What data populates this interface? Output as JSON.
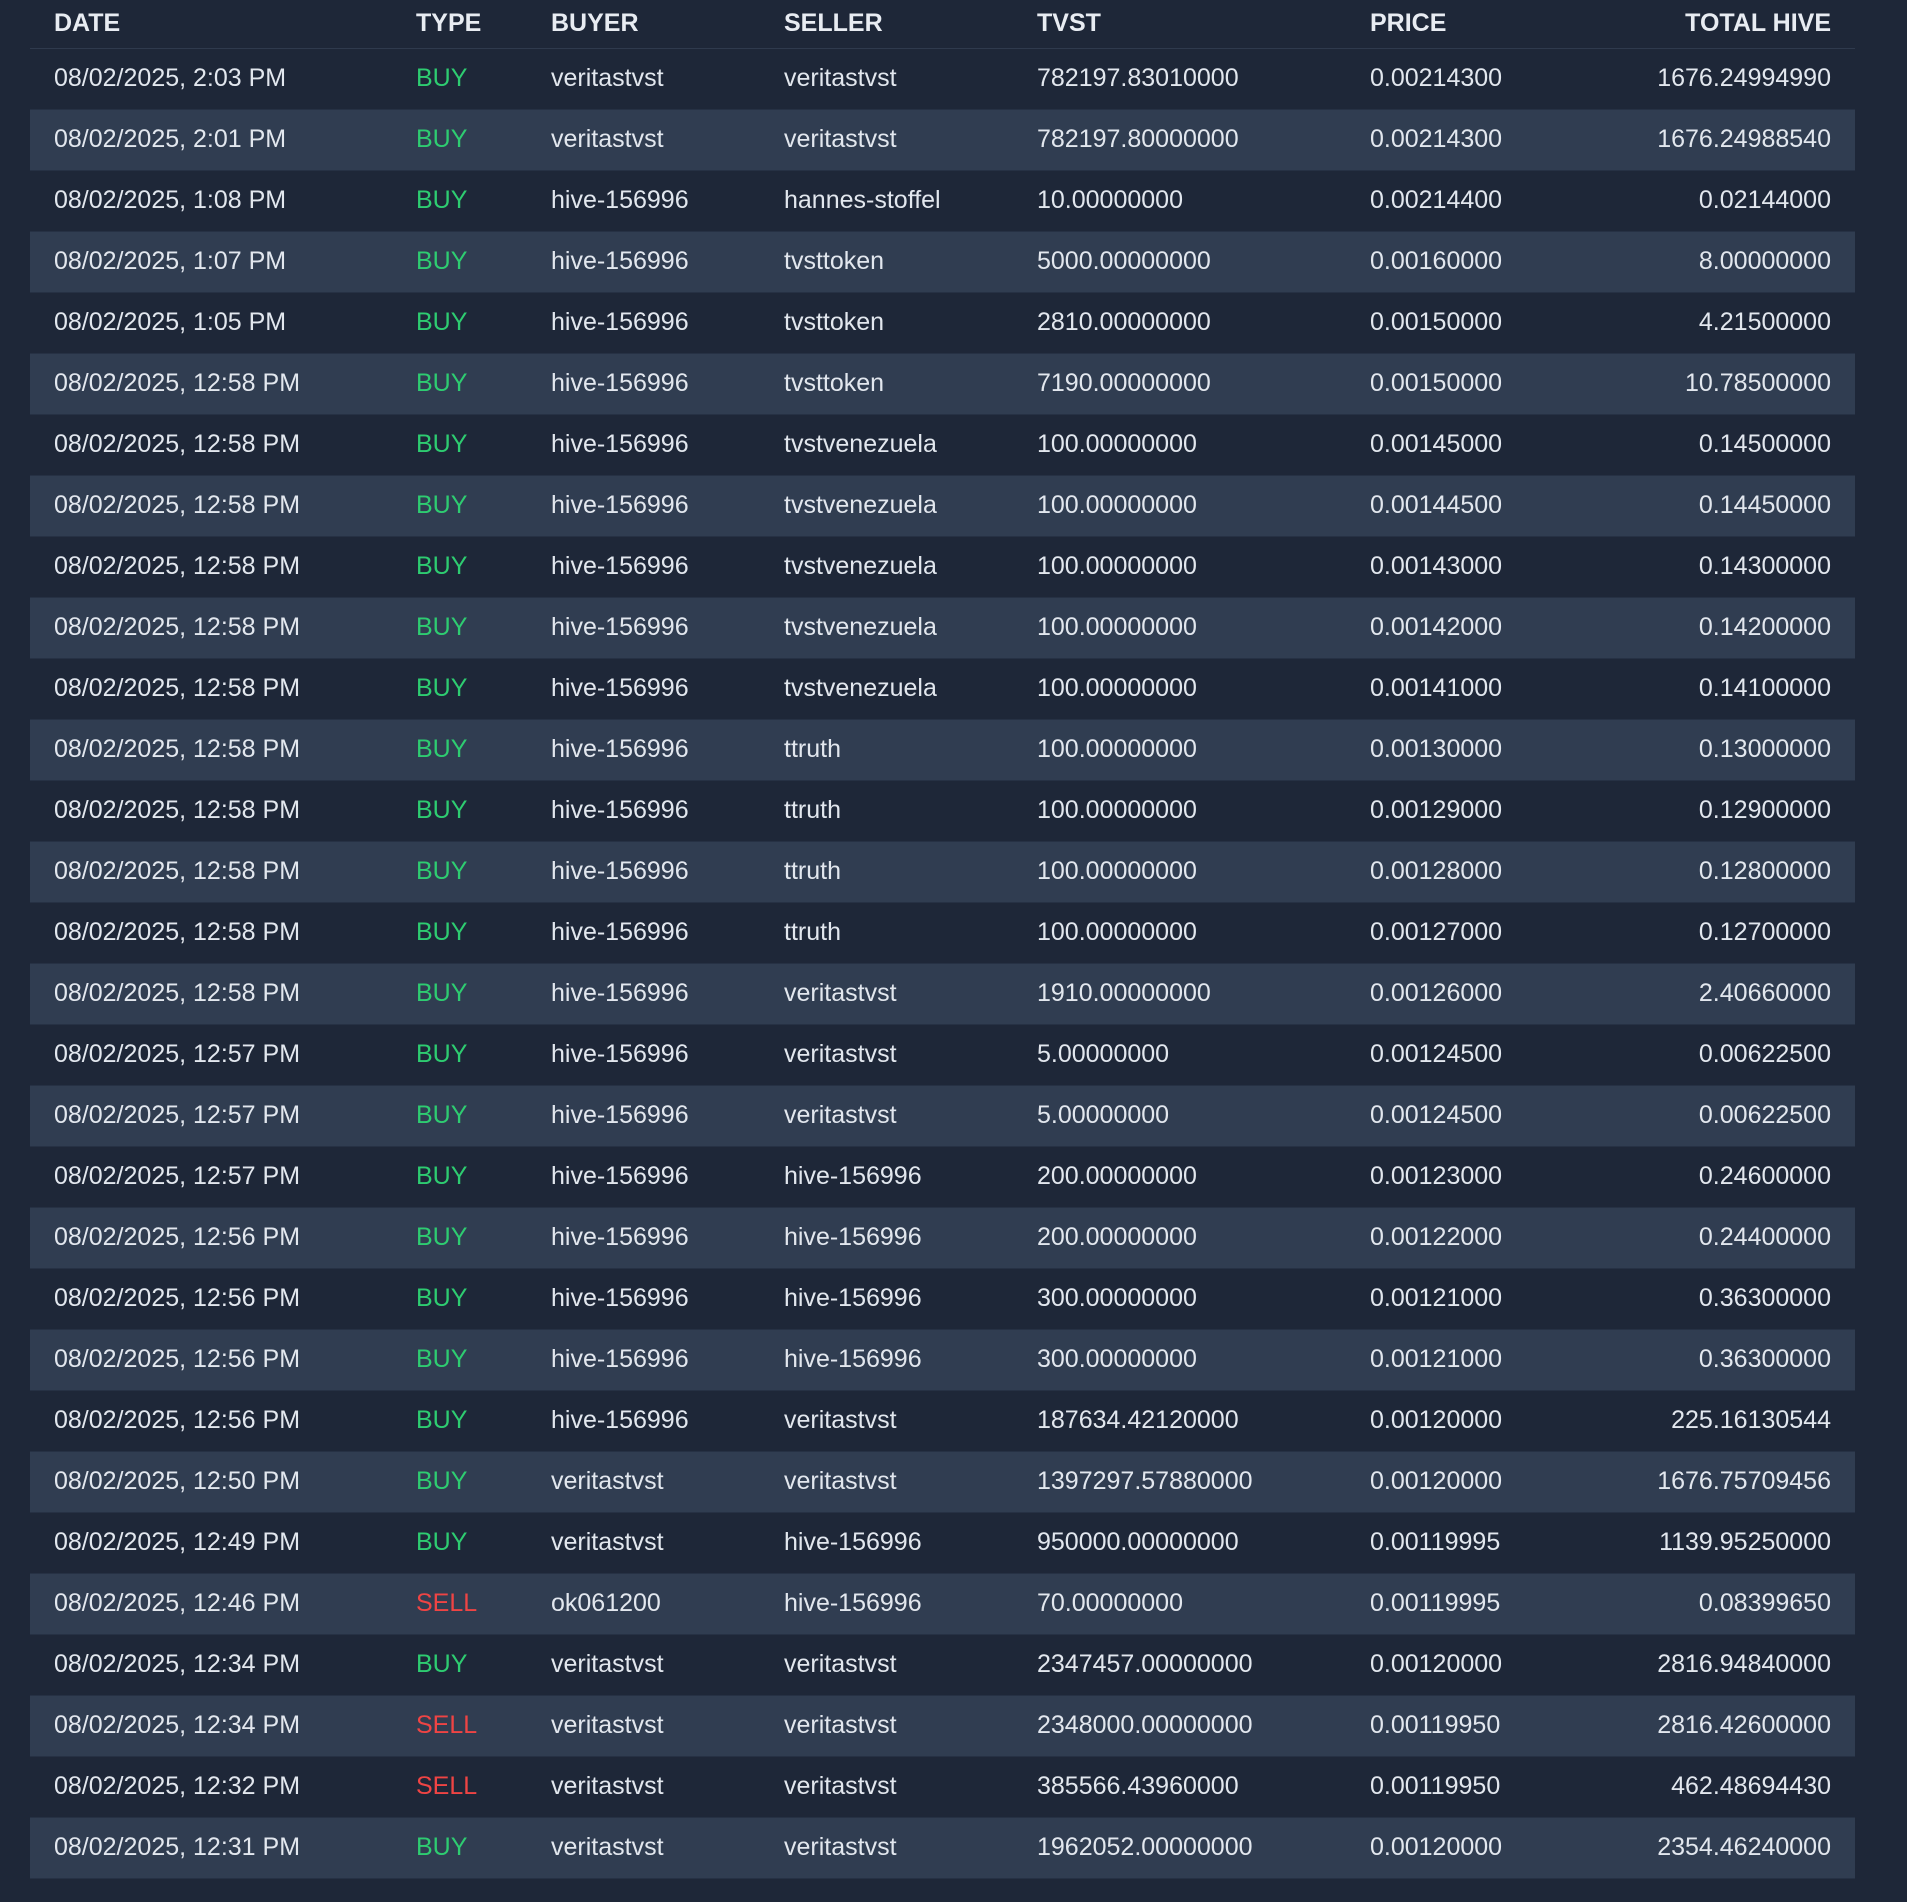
{
  "colors": {
    "background": "#1e2738",
    "row_alt": "#303d51",
    "buy": "#2ecc71",
    "sell": "#ef4444",
    "text": "#e2e7ee"
  },
  "table": {
    "headers": [
      "DATE",
      "TYPE",
      "BUYER",
      "SELLER",
      "TVST",
      "PRICE",
      "TOTAL HIVE"
    ],
    "rows": [
      [
        "08/02/2025, 2:03 PM",
        "BUY",
        "veritastvst",
        "veritastvst",
        "782197.83010000",
        "0.00214300",
        "1676.24994990"
      ],
      [
        "08/02/2025, 2:01 PM",
        "BUY",
        "veritastvst",
        "veritastvst",
        "782197.80000000",
        "0.00214300",
        "1676.24988540"
      ],
      [
        "08/02/2025, 1:08 PM",
        "BUY",
        "hive-156996",
        "hannes-stoffel",
        "10.00000000",
        "0.00214400",
        "0.02144000"
      ],
      [
        "08/02/2025, 1:07 PM",
        "BUY",
        "hive-156996",
        "tvsttoken",
        "5000.00000000",
        "0.00160000",
        "8.00000000"
      ],
      [
        "08/02/2025, 1:05 PM",
        "BUY",
        "hive-156996",
        "tvsttoken",
        "2810.00000000",
        "0.00150000",
        "4.21500000"
      ],
      [
        "08/02/2025, 12:58 PM",
        "BUY",
        "hive-156996",
        "tvsttoken",
        "7190.00000000",
        "0.00150000",
        "10.78500000"
      ],
      [
        "08/02/2025, 12:58 PM",
        "BUY",
        "hive-156996",
        "tvstvenezuela",
        "100.00000000",
        "0.00145000",
        "0.14500000"
      ],
      [
        "08/02/2025, 12:58 PM",
        "BUY",
        "hive-156996",
        "tvstvenezuela",
        "100.00000000",
        "0.00144500",
        "0.14450000"
      ],
      [
        "08/02/2025, 12:58 PM",
        "BUY",
        "hive-156996",
        "tvstvenezuela",
        "100.00000000",
        "0.00143000",
        "0.14300000"
      ],
      [
        "08/02/2025, 12:58 PM",
        "BUY",
        "hive-156996",
        "tvstvenezuela",
        "100.00000000",
        "0.00142000",
        "0.14200000"
      ],
      [
        "08/02/2025, 12:58 PM",
        "BUY",
        "hive-156996",
        "tvstvenezuela",
        "100.00000000",
        "0.00141000",
        "0.14100000"
      ],
      [
        "08/02/2025, 12:58 PM",
        "BUY",
        "hive-156996",
        "ttruth",
        "100.00000000",
        "0.00130000",
        "0.13000000"
      ],
      [
        "08/02/2025, 12:58 PM",
        "BUY",
        "hive-156996",
        "ttruth",
        "100.00000000",
        "0.00129000",
        "0.12900000"
      ],
      [
        "08/02/2025, 12:58 PM",
        "BUY",
        "hive-156996",
        "ttruth",
        "100.00000000",
        "0.00128000",
        "0.12800000"
      ],
      [
        "08/02/2025, 12:58 PM",
        "BUY",
        "hive-156996",
        "ttruth",
        "100.00000000",
        "0.00127000",
        "0.12700000"
      ],
      [
        "08/02/2025, 12:58 PM",
        "BUY",
        "hive-156996",
        "veritastvst",
        "1910.00000000",
        "0.00126000",
        "2.40660000"
      ],
      [
        "08/02/2025, 12:57 PM",
        "BUY",
        "hive-156996",
        "veritastvst",
        "5.00000000",
        "0.00124500",
        "0.00622500"
      ],
      [
        "08/02/2025, 12:57 PM",
        "BUY",
        "hive-156996",
        "veritastvst",
        "5.00000000",
        "0.00124500",
        "0.00622500"
      ],
      [
        "08/02/2025, 12:57 PM",
        "BUY",
        "hive-156996",
        "hive-156996",
        "200.00000000",
        "0.00123000",
        "0.24600000"
      ],
      [
        "08/02/2025, 12:56 PM",
        "BUY",
        "hive-156996",
        "hive-156996",
        "200.00000000",
        "0.00122000",
        "0.24400000"
      ],
      [
        "08/02/2025, 12:56 PM",
        "BUY",
        "hive-156996",
        "hive-156996",
        "300.00000000",
        "0.00121000",
        "0.36300000"
      ],
      [
        "08/02/2025, 12:56 PM",
        "BUY",
        "hive-156996",
        "hive-156996",
        "300.00000000",
        "0.00121000",
        "0.36300000"
      ],
      [
        "08/02/2025, 12:56 PM",
        "BUY",
        "hive-156996",
        "veritastvst",
        "187634.42120000",
        "0.00120000",
        "225.16130544"
      ],
      [
        "08/02/2025, 12:50 PM",
        "BUY",
        "veritastvst",
        "veritastvst",
        "1397297.57880000",
        "0.00120000",
        "1676.75709456"
      ],
      [
        "08/02/2025, 12:49 PM",
        "BUY",
        "veritastvst",
        "hive-156996",
        "950000.00000000",
        "0.00119995",
        "1139.95250000"
      ],
      [
        "08/02/2025, 12:46 PM",
        "SELL",
        "ok061200",
        "hive-156996",
        "70.00000000",
        "0.00119995",
        "0.08399650"
      ],
      [
        "08/02/2025, 12:34 PM",
        "BUY",
        "veritastvst",
        "veritastvst",
        "2347457.00000000",
        "0.00120000",
        "2816.94840000"
      ],
      [
        "08/02/2025, 12:34 PM",
        "SELL",
        "veritastvst",
        "veritastvst",
        "2348000.00000000",
        "0.00119950",
        "2816.42600000"
      ],
      [
        "08/02/2025, 12:32 PM",
        "SELL",
        "veritastvst",
        "veritastvst",
        "385566.43960000",
        "0.00119950",
        "462.48694430"
      ],
      [
        "08/02/2025, 12:31 PM",
        "BUY",
        "veritastvst",
        "veritastvst",
        "1962052.00000000",
        "0.00120000",
        "2354.46240000"
      ]
    ]
  }
}
